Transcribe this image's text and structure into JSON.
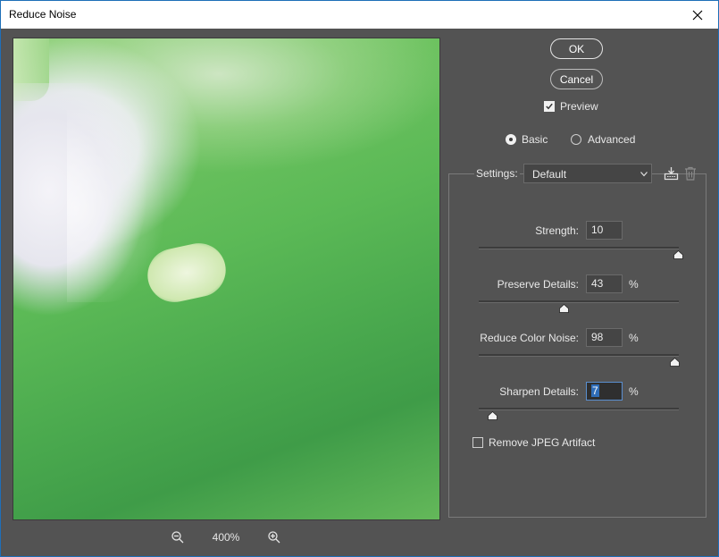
{
  "window": {
    "title": "Reduce Noise"
  },
  "preview": {
    "zoom_level": "400%"
  },
  "buttons": {
    "ok": "OK",
    "cancel": "Cancel"
  },
  "preview_toggle": {
    "label": "Preview",
    "checked": true
  },
  "mode": {
    "basic": "Basic",
    "advanced": "Advanced",
    "selected": "Basic"
  },
  "settings": {
    "label": "Settings:",
    "value": "Default"
  },
  "sliders": [
    {
      "label": "Strength:",
      "value": "10",
      "unit": "",
      "level": 1.0
    },
    {
      "label": "Preserve Details:",
      "value": "43",
      "unit": "%",
      "level": 0.43
    },
    {
      "label": "Reduce Color Noise:",
      "value": "98",
      "unit": "%",
      "level": 0.98
    },
    {
      "label": "Sharpen Details:",
      "value": "7",
      "unit": "%",
      "level": 0.07
    }
  ],
  "jpeg": {
    "label": "Remove JPEG Artifact",
    "checked": false
  },
  "colors": {
    "accent": "#2f6db8",
    "background": "#535353"
  }
}
